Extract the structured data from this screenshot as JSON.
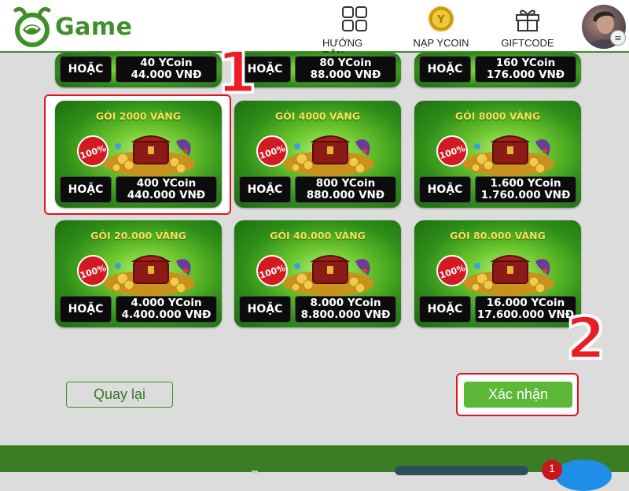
{
  "brand": {
    "name": "Game"
  },
  "nav": [
    {
      "label": "HƯỚNG DẪN",
      "icon": "grid-icon"
    },
    {
      "label": "NẠP YCOIN",
      "icon": "coin-icon"
    },
    {
      "label": "GIFTCODE",
      "icon": "gift-icon"
    }
  ],
  "packages_partial": [
    {
      "or": "HOẶC",
      "ycoin": "40 YCoin",
      "vnd": "44.000 VNĐ"
    },
    {
      "or": "HOẶC",
      "ycoin": "80 YCoin",
      "vnd": "88.000 VNĐ"
    },
    {
      "or": "HOẶC",
      "ycoin": "160 YCoin",
      "vnd": "176.000 VNĐ"
    }
  ],
  "packages": [
    {
      "title": "GÓI 2000 VÀNG",
      "badge": "100%",
      "or": "HOẶC",
      "ycoin": "400 YCoin",
      "vnd": "440.000 VNĐ",
      "selected": true
    },
    {
      "title": "GÓI 4000 VÀNG",
      "badge": "100%",
      "or": "HOẶC",
      "ycoin": "800 YCoin",
      "vnd": "880.000 VNĐ"
    },
    {
      "title": "GÓI 8000 VÀNG",
      "badge": "100%",
      "or": "HOẶC",
      "ycoin": "1.600 YCoin",
      "vnd": "1.760.000 VNĐ"
    },
    {
      "title": "GÓI 20.000 VÀNG",
      "badge": "100%",
      "or": "HOẶC",
      "ycoin": "4.000 YCoin",
      "vnd": "4.400.000 VNĐ"
    },
    {
      "title": "GÓI 40.000 VÀNG",
      "badge": "100%",
      "or": "HOẶC",
      "ycoin": "8.000 YCoin",
      "vnd": "8.800.000 VNĐ"
    },
    {
      "title": "GÓI 80.000 VÀNG",
      "badge": "100%",
      "or": "HOẶC",
      "ycoin": "16.000 YCoin",
      "vnd": "17.600.000 VNĐ"
    }
  ],
  "annotations": {
    "step1": "1",
    "step2": "2"
  },
  "buttons": {
    "back": "Quay lại",
    "confirm": "Xác nhận"
  },
  "footer": {
    "notification_count": "1"
  },
  "colors": {
    "brand_green": "#3f8f2a",
    "confirm_green": "#5cb837",
    "highlight_red": "#e0141c",
    "step_red": "#ec1c24",
    "title_gold": "#f6e15a"
  }
}
